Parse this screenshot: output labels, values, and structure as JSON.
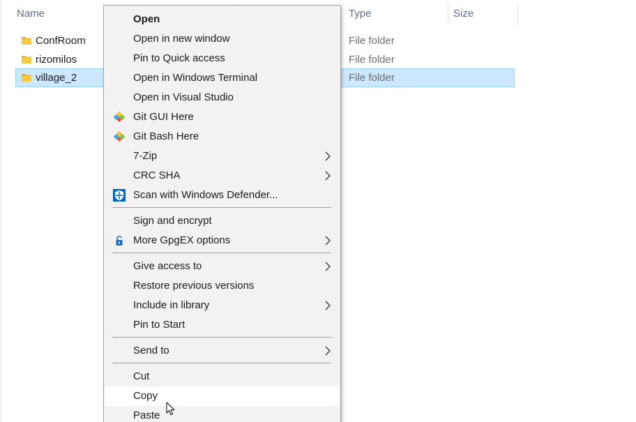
{
  "columns": {
    "name": "Name",
    "type": "Type",
    "size": "Size"
  },
  "files": [
    {
      "name": "ConfRoom",
      "type": "File folder"
    },
    {
      "name": "rizomilos",
      "type": "File folder"
    },
    {
      "name": "village_2",
      "type": "File folder"
    }
  ],
  "menu": {
    "open": "Open",
    "open_new_window": "Open in new window",
    "pin_quick_access": "Pin to Quick access",
    "open_terminal": "Open in Windows Terminal",
    "open_visual_studio": "Open in Visual Studio",
    "git_gui": "Git GUI Here",
    "git_bash": "Git Bash Here",
    "seven_zip": "7-Zip",
    "crc_sha": "CRC SHA",
    "scan_defender": "Scan with Windows Defender...",
    "sign_encrypt": "Sign and encrypt",
    "more_gpgex": "More GpgEX options",
    "give_access": "Give access to",
    "restore_versions": "Restore previous versions",
    "include_library": "Include in library",
    "pin_start": "Pin to Start",
    "send_to": "Send to",
    "cut": "Cut",
    "copy": "Copy",
    "paste": "Paste"
  },
  "icons": {
    "folder": "folder-icon",
    "git": "git-icon",
    "defender": "windows-defender-shield-icon",
    "gpg": "padlock-icon",
    "submenu": "chevron-right-icon",
    "cursor": "mouse-pointer-icon"
  },
  "colors": {
    "selection_fill": "#cce8ff",
    "selection_border": "#99d1ff",
    "menu_bg": "#f2f2f2",
    "hover_bg": "#ffffff",
    "folder": "#f6c843",
    "defender_blue": "#0067c0"
  }
}
